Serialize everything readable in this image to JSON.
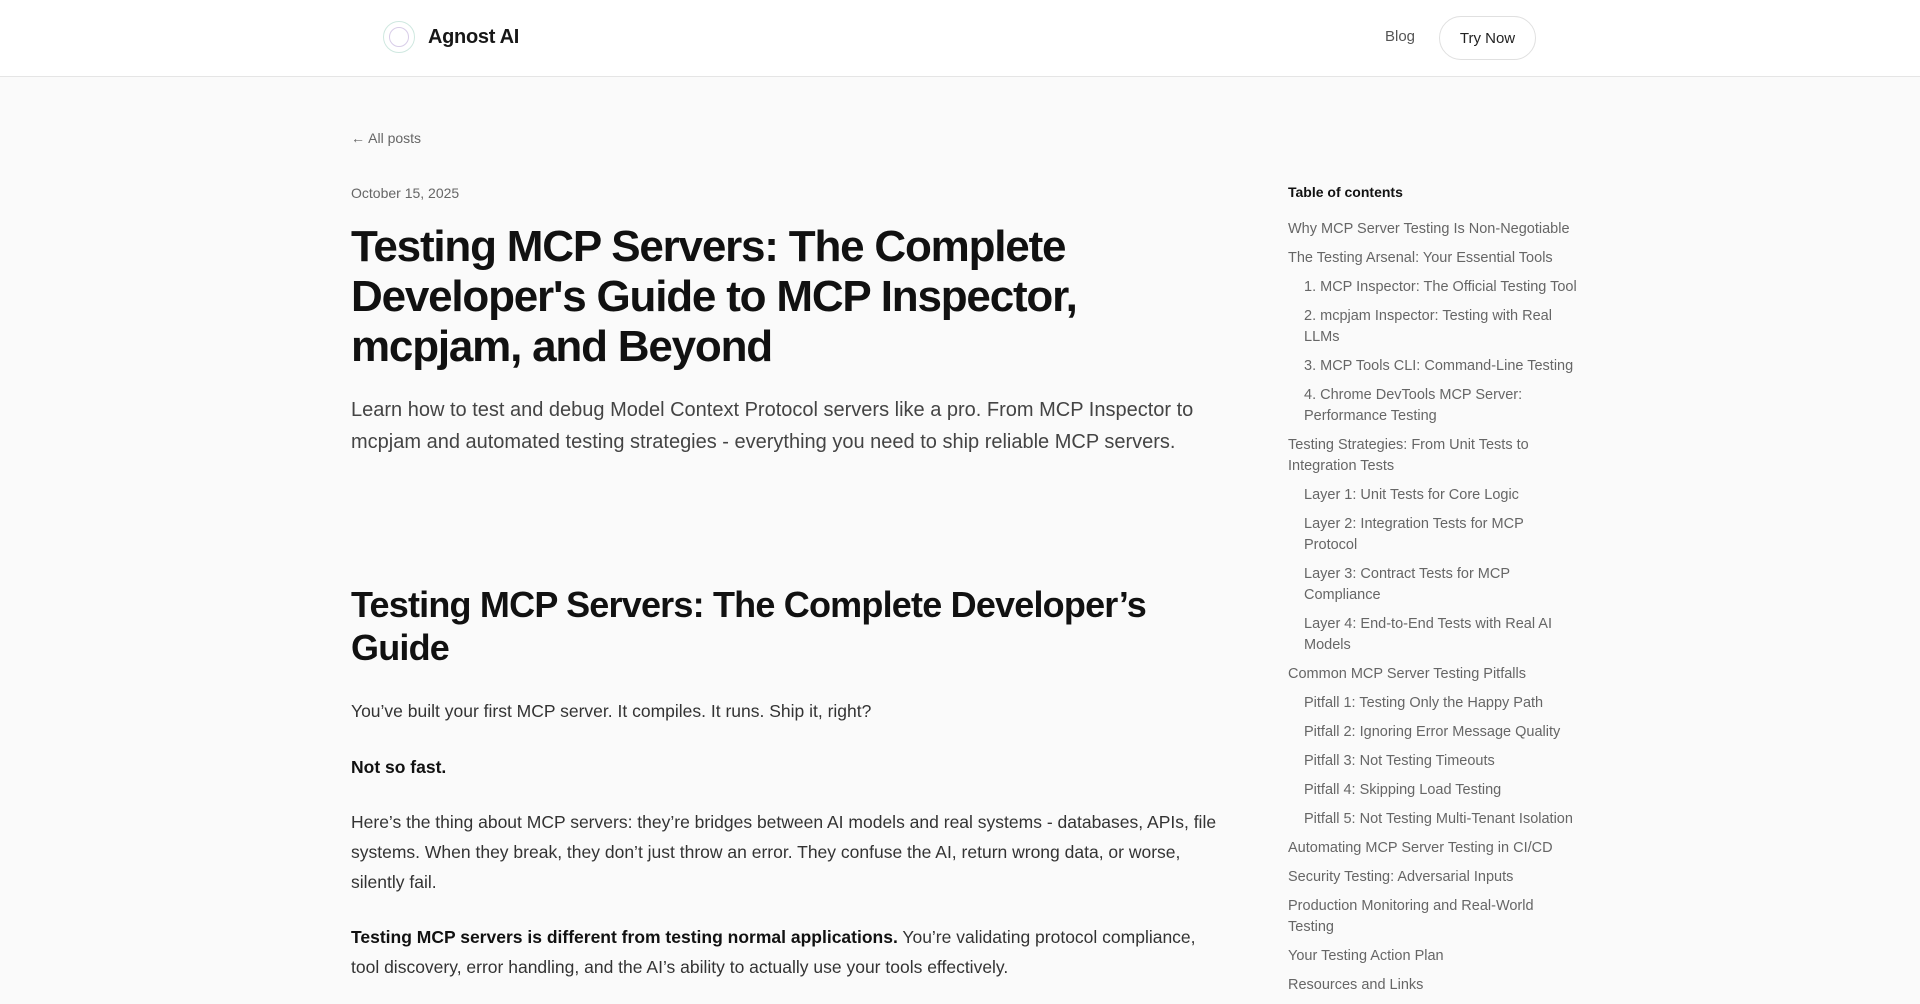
{
  "header": {
    "brand": "Agnost AI",
    "blog": "Blog",
    "try_now": "Try Now"
  },
  "back_link": "← All posts",
  "post": {
    "date": "October 15, 2025",
    "title": "Testing MCP Servers: The Complete Developer's Guide to MCP Inspector, mcpjam, and Beyond",
    "subtitle": "Learn how to test and debug Model Context Protocol servers like a pro. From MCP Inspector to mcpjam and automated testing strategies - everything you need to ship reliable MCP servers.",
    "h2": "Testing MCP Servers: The Complete Developer’s Guide",
    "p1": "You’ve built your first MCP server. It compiles. It runs. Ship it, right?",
    "p2": "Not so fast.",
    "p3": "Here’s the thing about MCP servers: they’re bridges between AI models and real systems - databases, APIs, file systems. When they break, they don’t just throw an error. They confuse the AI, return wrong data, or worse, silently fail.",
    "p4_bold": "Testing MCP servers is different from testing normal applications.",
    "p4_rest": " You’re validating protocol compliance, tool discovery, error handling, and the AI’s ability to actually use your tools effectively."
  },
  "toc": {
    "title": "Table of contents",
    "items": [
      {
        "label": "Why MCP Server Testing Is Non-Negotiable",
        "level": 1
      },
      {
        "label": "The Testing Arsenal: Your Essential Tools",
        "level": 1
      },
      {
        "label": "1. MCP Inspector: The Official Testing Tool",
        "level": 2
      },
      {
        "label": "2. mcpjam Inspector: Testing with Real LLMs",
        "level": 2
      },
      {
        "label": "3. MCP Tools CLI: Command-Line Testing",
        "level": 2
      },
      {
        "label": "4. Chrome DevTools MCP Server: Performance Testing",
        "level": 2
      },
      {
        "label": "Testing Strategies: From Unit Tests to Integration Tests",
        "level": 1
      },
      {
        "label": "Layer 1: Unit Tests for Core Logic",
        "level": 2
      },
      {
        "label": "Layer 2: Integration Tests for MCP Protocol",
        "level": 2
      },
      {
        "label": "Layer 3: Contract Tests for MCP Compliance",
        "level": 2
      },
      {
        "label": "Layer 4: End-to-End Tests with Real AI Models",
        "level": 2
      },
      {
        "label": "Common MCP Server Testing Pitfalls",
        "level": 1
      },
      {
        "label": "Pitfall 1: Testing Only the Happy Path",
        "level": 2
      },
      {
        "label": "Pitfall 2: Ignoring Error Message Quality",
        "level": 2
      },
      {
        "label": "Pitfall 3: Not Testing Timeouts",
        "level": 2
      },
      {
        "label": "Pitfall 4: Skipping Load Testing",
        "level": 2
      },
      {
        "label": "Pitfall 5: Not Testing Multi-Tenant Isolation",
        "level": 2
      },
      {
        "label": "Automating MCP Server Testing in CI/CD",
        "level": 1
      },
      {
        "label": "Security Testing: Adversarial Inputs",
        "level": 1
      },
      {
        "label": "Production Monitoring and Real-World Testing",
        "level": 1
      },
      {
        "label": "Your Testing Action Plan",
        "level": 1
      },
      {
        "label": "Resources and Links",
        "level": 1
      }
    ]
  }
}
